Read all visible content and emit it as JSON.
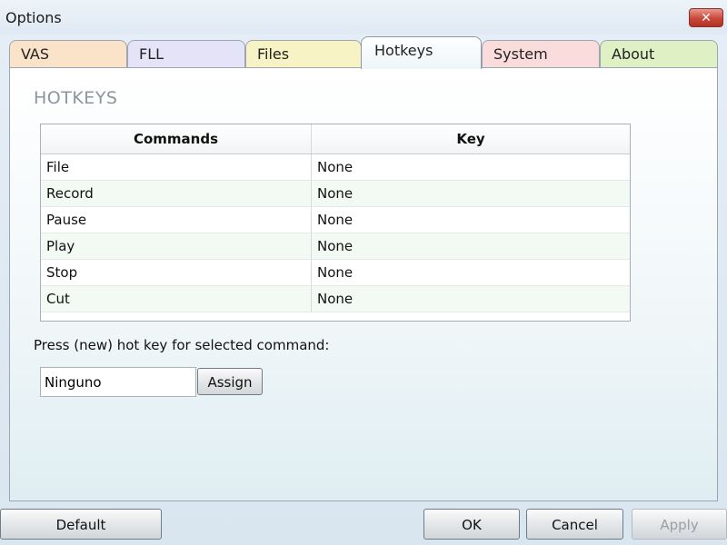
{
  "window": {
    "title": "Options",
    "close_label": "✕"
  },
  "tabs": [
    {
      "label": "VAS",
      "color": "#fbe3c9"
    },
    {
      "label": "FLL",
      "color": "#e4e3f7"
    },
    {
      "label": "Files",
      "color": "#f7f3c4"
    },
    {
      "label": "Hotkeys",
      "color": "#ffffff",
      "active": true
    },
    {
      "label": "System",
      "color": "#fbdcdc"
    },
    {
      "label": "About",
      "color": "#dff1c4"
    }
  ],
  "hotkeys": {
    "section_title": "HOTKEYS",
    "table": {
      "headers": [
        "Commands",
        "Key"
      ],
      "rows": [
        {
          "command": "File",
          "key": "None"
        },
        {
          "command": "Record",
          "key": "None"
        },
        {
          "command": "Pause",
          "key": "None"
        },
        {
          "command": "Play",
          "key": "None"
        },
        {
          "command": "Stop",
          "key": "None"
        },
        {
          "command": "Cut",
          "key": "None"
        }
      ]
    },
    "prompt": "Press (new) hot key for selected command:",
    "input_value": "Ninguno",
    "assign_label": "Assign"
  },
  "footer": {
    "default_label": "Default",
    "ok_label": "OK",
    "cancel_label": "Cancel",
    "apply_label": "Apply"
  }
}
